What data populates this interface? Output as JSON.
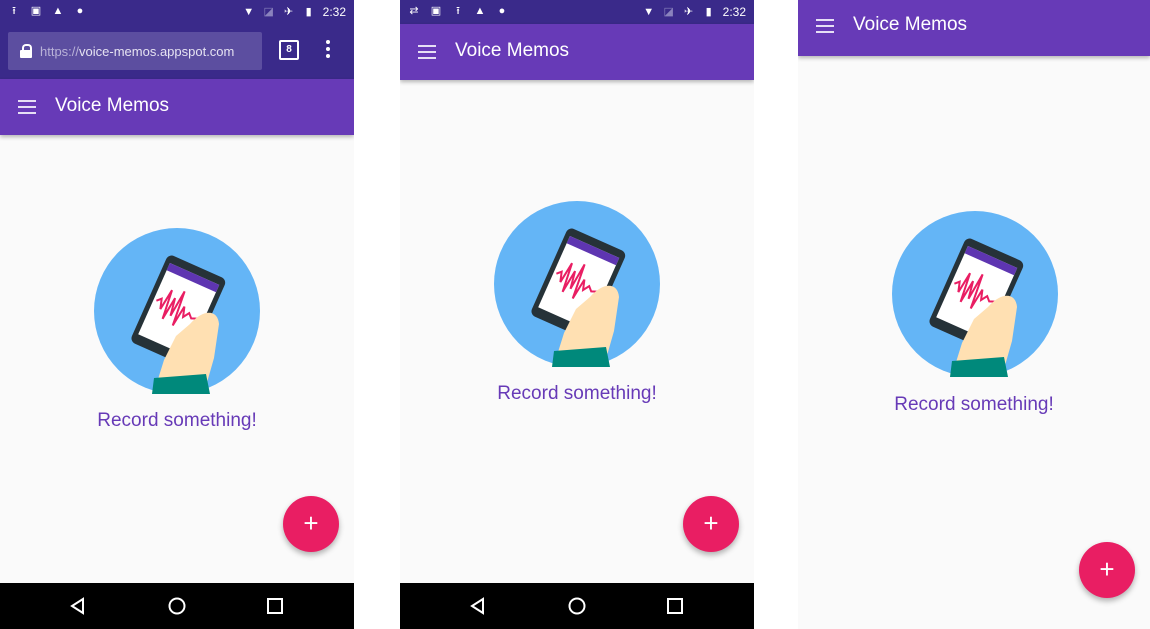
{
  "status_bar": {
    "time": "2:32"
  },
  "browser": {
    "url_scheme": "https://",
    "url_host": "voice-memos.appspot.com",
    "tab_count": "8"
  },
  "app": {
    "title": "Voice Memos",
    "empty_message": "Record something!",
    "fab_label": "+"
  },
  "colors": {
    "status_bar": "#3a2a8a",
    "app_bar": "#673ab7",
    "accent": "#e91e63",
    "background": "#fafafa",
    "illustration_circle": "#64b5f6"
  },
  "icons": [
    "hamburger-menu-icon",
    "lock-icon",
    "tabs-icon",
    "overflow-menu-icon",
    "back-icon",
    "home-icon",
    "recents-icon",
    "wifi-icon",
    "airplane-icon",
    "battery-icon"
  ]
}
